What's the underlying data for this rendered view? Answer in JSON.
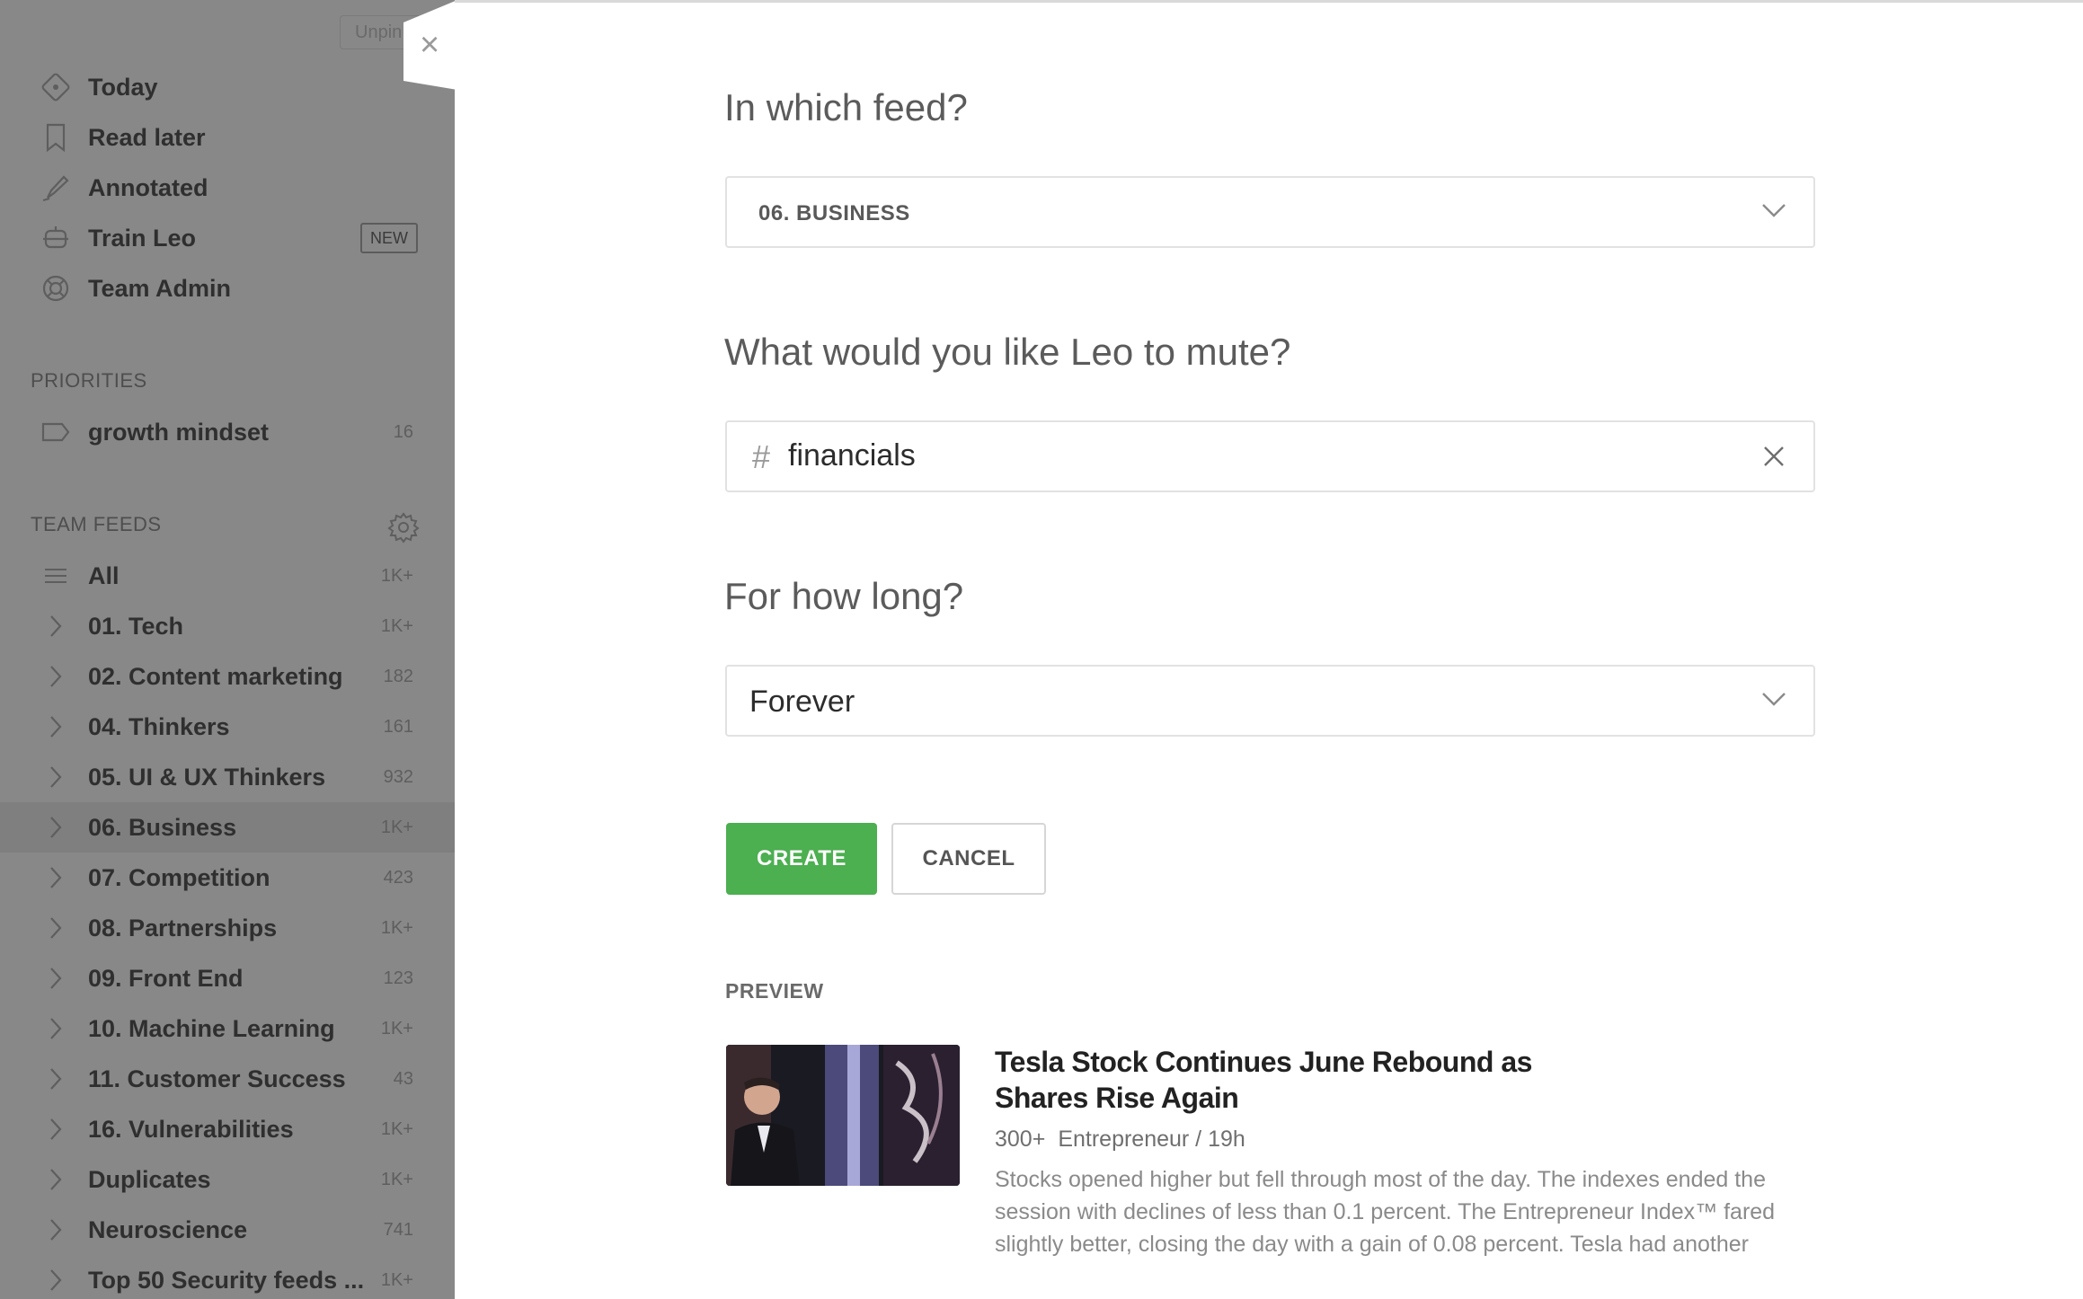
{
  "sidebar": {
    "unpin_label": "Unpin",
    "main_items": [
      {
        "label": "Today",
        "icon": "today-icon"
      },
      {
        "label": "Read later",
        "icon": "bookmark-icon"
      },
      {
        "label": "Annotated",
        "icon": "highlighter-icon"
      },
      {
        "label": "Train Leo",
        "icon": "robot-icon",
        "badge": "NEW"
      },
      {
        "label": "Team Admin",
        "icon": "lifebuoy-icon"
      }
    ],
    "priorities_title": "PRIORITIES",
    "priorities": [
      {
        "label": "growth mindset",
        "count": "16",
        "icon": "tag-icon"
      }
    ],
    "team_feeds_title": "TEAM FEEDS",
    "feeds": [
      {
        "label": "All",
        "count": "1K+"
      },
      {
        "label": "01. Tech",
        "count": "1K+"
      },
      {
        "label": "02. Content marketing",
        "count": "182"
      },
      {
        "label": "04. Thinkers",
        "count": "161"
      },
      {
        "label": "05. UI & UX Thinkers",
        "count": "932"
      },
      {
        "label": "06. Business",
        "count": "1K+",
        "active": true
      },
      {
        "label": "07. Competition",
        "count": "423"
      },
      {
        "label": "08. Partnerships",
        "count": "1K+"
      },
      {
        "label": "09. Front End",
        "count": "123"
      },
      {
        "label": "10. Machine Learning",
        "count": "1K+"
      },
      {
        "label": "11. Customer Success",
        "count": "43"
      },
      {
        "label": "16. Vulnerabilities",
        "count": "1K+"
      },
      {
        "label": "Duplicates",
        "count": "1K+"
      },
      {
        "label": "Neuroscience",
        "count": "741"
      },
      {
        "label": "Top 50 Security feeds ...",
        "count": "1K+"
      }
    ]
  },
  "modal": {
    "close_symbol": "×",
    "q_feed": "In which feed?",
    "feed_selected": "06. BUSINESS",
    "q_mute": "What would you like Leo to mute?",
    "mute_hash": "#",
    "mute_value": "financials",
    "q_duration": "For how long?",
    "duration_selected": "Forever",
    "create_label": "CREATE",
    "cancel_label": "CANCEL",
    "preview_label": "PREVIEW",
    "article": {
      "title": "Tesla Stock Continues June Rebound as Shares Rise Again",
      "count": "300+",
      "source": "Entrepreneur / 19h",
      "excerpt": "Stocks opened higher but fell through most of the day. The indexes ended the session with declines of less than 0.1 percent. The Entrepreneur Index™ fared slightly better, closing the day with a gain of 0.08 percent. Tesla had another"
    }
  },
  "colors": {
    "accent_green": "#4caf50",
    "sidebar_overlay": "#888888",
    "active_row": "#7f7f7f"
  }
}
